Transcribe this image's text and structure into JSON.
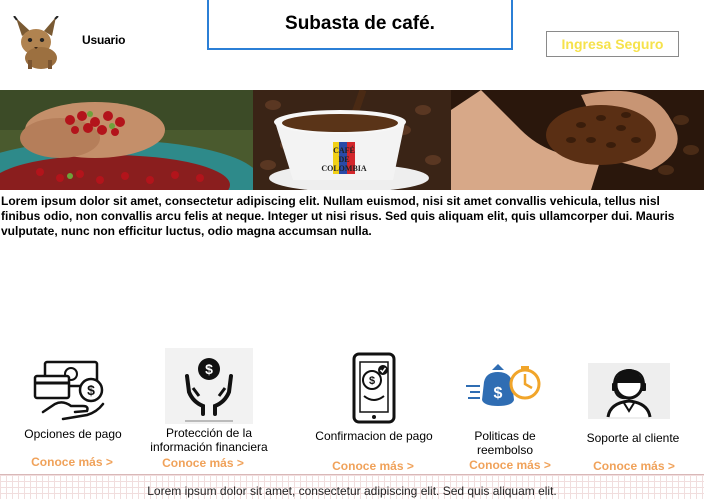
{
  "header": {
    "username": "Usuario",
    "title": "Subasta de café.",
    "login_label": "Ingresa Seguro"
  },
  "banner": {
    "mug_text_line1": "CAFÉ",
    "mug_text_line2": "DE",
    "mug_text_line3": "COLOMBIA"
  },
  "intro_text": "Lorem ipsum dolor sit amet, consectetur adipiscing elit. Nullam euismod, nisi sit amet convallis vehicula, tellus nisl finibus odio, non convallis arcu felis at neque. Integer ut nisi risus. Sed quis aliquam elit, quis ullamcorper dui. Mauris vulputate, nunc non efficitur luctus, odio magna accumsan nulla.",
  "services": [
    {
      "label": "Opciones de pago",
      "link": "Conoce más >"
    },
    {
      "label": "Protección de la información financiera",
      "link": "Conoce más >"
    },
    {
      "label": "Confirmacion de pago",
      "link": "Conoce más >"
    },
    {
      "label": "Politicas de reembolso",
      "link": "Conoce más >"
    },
    {
      "label": "Soporte al cliente",
      "link": "Conoce más >"
    }
  ],
  "footer_text": "Lorem ipsum dolor sit amet, consectetur adipiscing elit. Sed quis aliquam elit.",
  "colors": {
    "title_border": "#2b7fd6",
    "login_text": "#f6e24b",
    "link": "#f0a25a"
  }
}
